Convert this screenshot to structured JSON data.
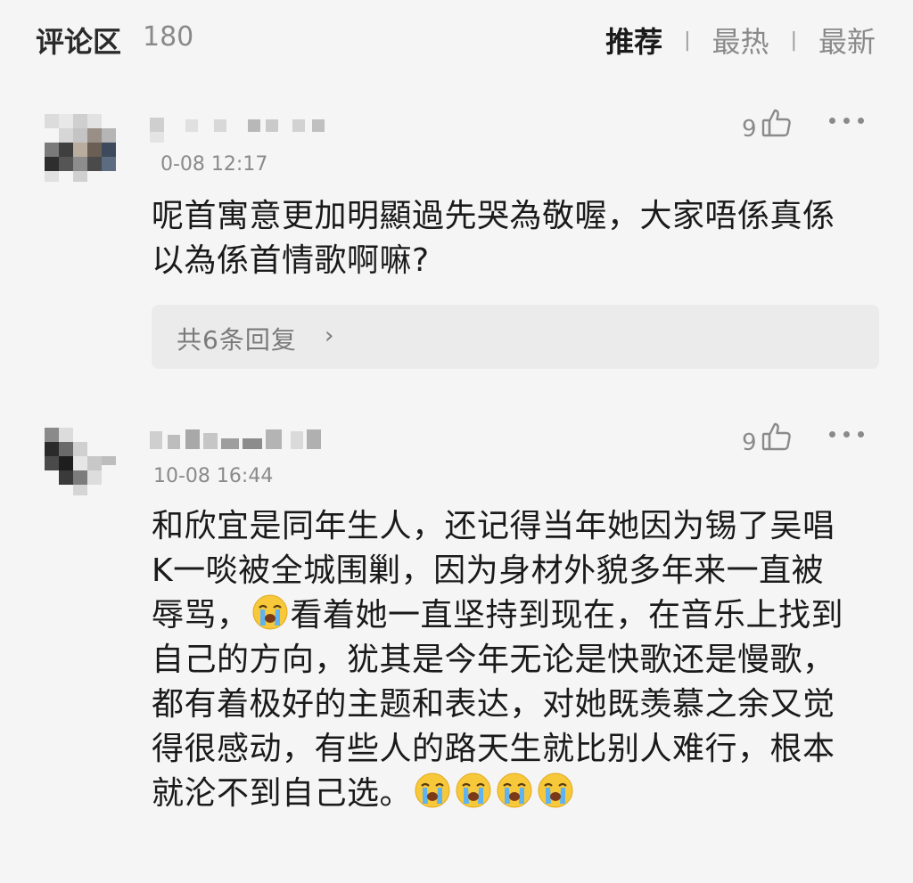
{
  "header": {
    "title": "评论区",
    "count": "180",
    "sort_tabs": [
      {
        "label": "推荐",
        "active": true
      },
      {
        "label": "最热",
        "active": false
      },
      {
        "label": "最新",
        "active": false
      }
    ],
    "separator": "|"
  },
  "comments": [
    {
      "time": "0-08 12:17",
      "likes": "9",
      "text_lines": [
        "呢首寓意更加明顯過先哭為敬喔，大家唔係真係",
        "以為係首情歌啊嘛?"
      ],
      "reply_label": "共6条回复",
      "reply_chevron": "›"
    },
    {
      "time": "10-08 16:44",
      "likes": "9",
      "text_lines": [
        "和欣宜是同年生人，还记得当年她因为锡了吴唱",
        "K一啖被全城围剿，因为身材外貌多年来一直被",
        "辱骂，",
        "看着她一直坚持到现在，在音乐上找到",
        "自己的方向，犹其是今年无论是快歌还是慢歌，",
        "都有着极好的主题和表达，对她既羡慕之余又觉",
        "得很感动，有些人的路天生就比别人难行，根本",
        "就沦不到自己选。"
      ]
    }
  ],
  "icons": {
    "like": "thumb-up-icon",
    "more": "more-dots-icon",
    "emoji": "loudly-crying-face-icon"
  },
  "colors": {
    "background": "#f5f5f5",
    "text": "#1a1a1a",
    "muted": "#8a8a8a",
    "reply_bg": "#ebebeb"
  }
}
